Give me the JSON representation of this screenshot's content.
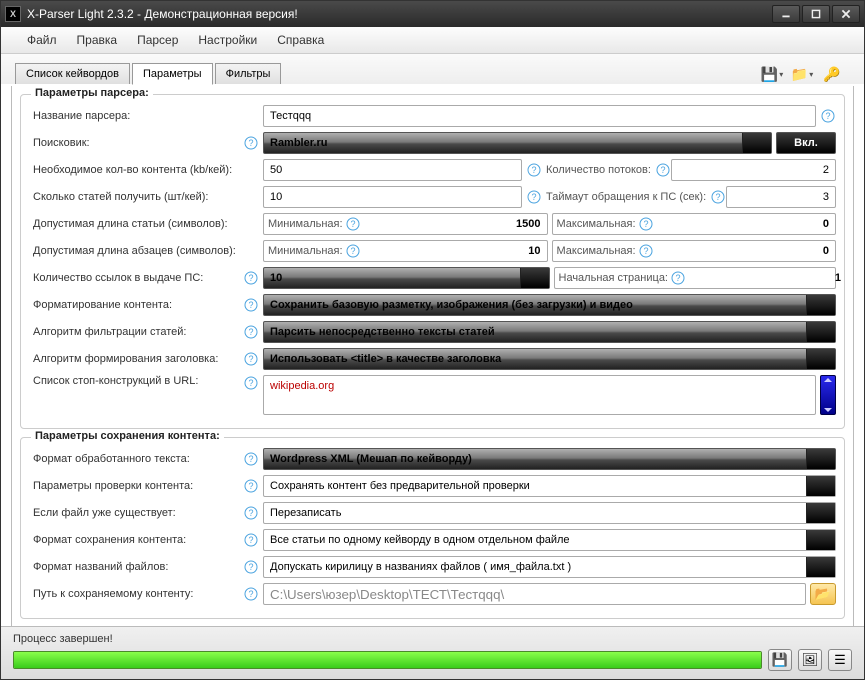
{
  "window": {
    "title": "X-Parser Light 2.3.2 - Демонстрационная версия!"
  },
  "menu": {
    "file": "Файл",
    "edit": "Правка",
    "parser": "Парсер",
    "settings": "Настройки",
    "help": "Справка"
  },
  "tabs": {
    "keywords": "Список кейвордов",
    "params": "Параметры",
    "filters": "Фильтры"
  },
  "group1": {
    "title": "Параметры парсера:",
    "parser_name_label": "Название парсера:",
    "parser_name_value": "Тестqqq",
    "search_engine_label": "Поисковик:",
    "search_engine_value": "Rambler.ru",
    "toggle_on": "Вкл.",
    "content_kb_label": "Необходимое кол-во контента (kb/кей):",
    "content_kb_value": "50",
    "threads_label": "Количество потоков:",
    "threads_value": "2",
    "articles_label": "Сколько статей получить (шт/кей):",
    "articles_value": "10",
    "timeout_label": "Таймаут обращения к ПС (сек):",
    "timeout_value": "3",
    "art_len_label": "Допустимая длина статьи (символов):",
    "min_label": "Минимальная:",
    "max_label": "Максимальная:",
    "art_min": "1500",
    "art_max": "0",
    "para_len_label": "Допустимая длина абзацев (символов):",
    "para_min": "10",
    "para_max": "0",
    "serp_links_label": "Количество ссылок в выдаче ПС:",
    "serp_links_value": "10",
    "start_page_label": "Начальная страница:",
    "start_page_value": "1",
    "formatting_label": "Форматирование контента:",
    "formatting_value": "Сохранить базовую разметку, изображения (без загрузки) и видео",
    "filter_algo_label": "Алгоритм фильтрации статей:",
    "filter_algo_value": "Парсить непосредственно тексты статей",
    "title_algo_label": "Алгоритм формирования заголовка:",
    "title_algo_value": "Использовать <title> в качестве заголовка",
    "stop_url_label": "Список стоп-конструкций в URL:",
    "stop_url_value": "wikipedia.org"
  },
  "group2": {
    "title": "Параметры сохранения контента:",
    "format_label": "Формат обработанного текста:",
    "format_value": "Wordpress XML (Мешап по кейворду)",
    "check_label": "Параметры проверки контента:",
    "check_value": "Сохранять контент без предварительной проверки",
    "exists_label": "Если файл уже существует:",
    "exists_value": "Перезаписать",
    "save_fmt_label": "Формат сохранения контента:",
    "save_fmt_value": "Все статьи по одному кейворду в одном отдельном файле",
    "fname_label": "Формат названий файлов:",
    "fname_value": "Допускать кирилицу в названиях файлов ( имя_файла.txt )",
    "path_label": "Путь к сохраняемому контенту:",
    "path_value": "C:\\Users\\юзер\\Desktop\\ТЕСТ\\Тестqqq\\"
  },
  "status": {
    "text": "Процесс завершен!"
  }
}
